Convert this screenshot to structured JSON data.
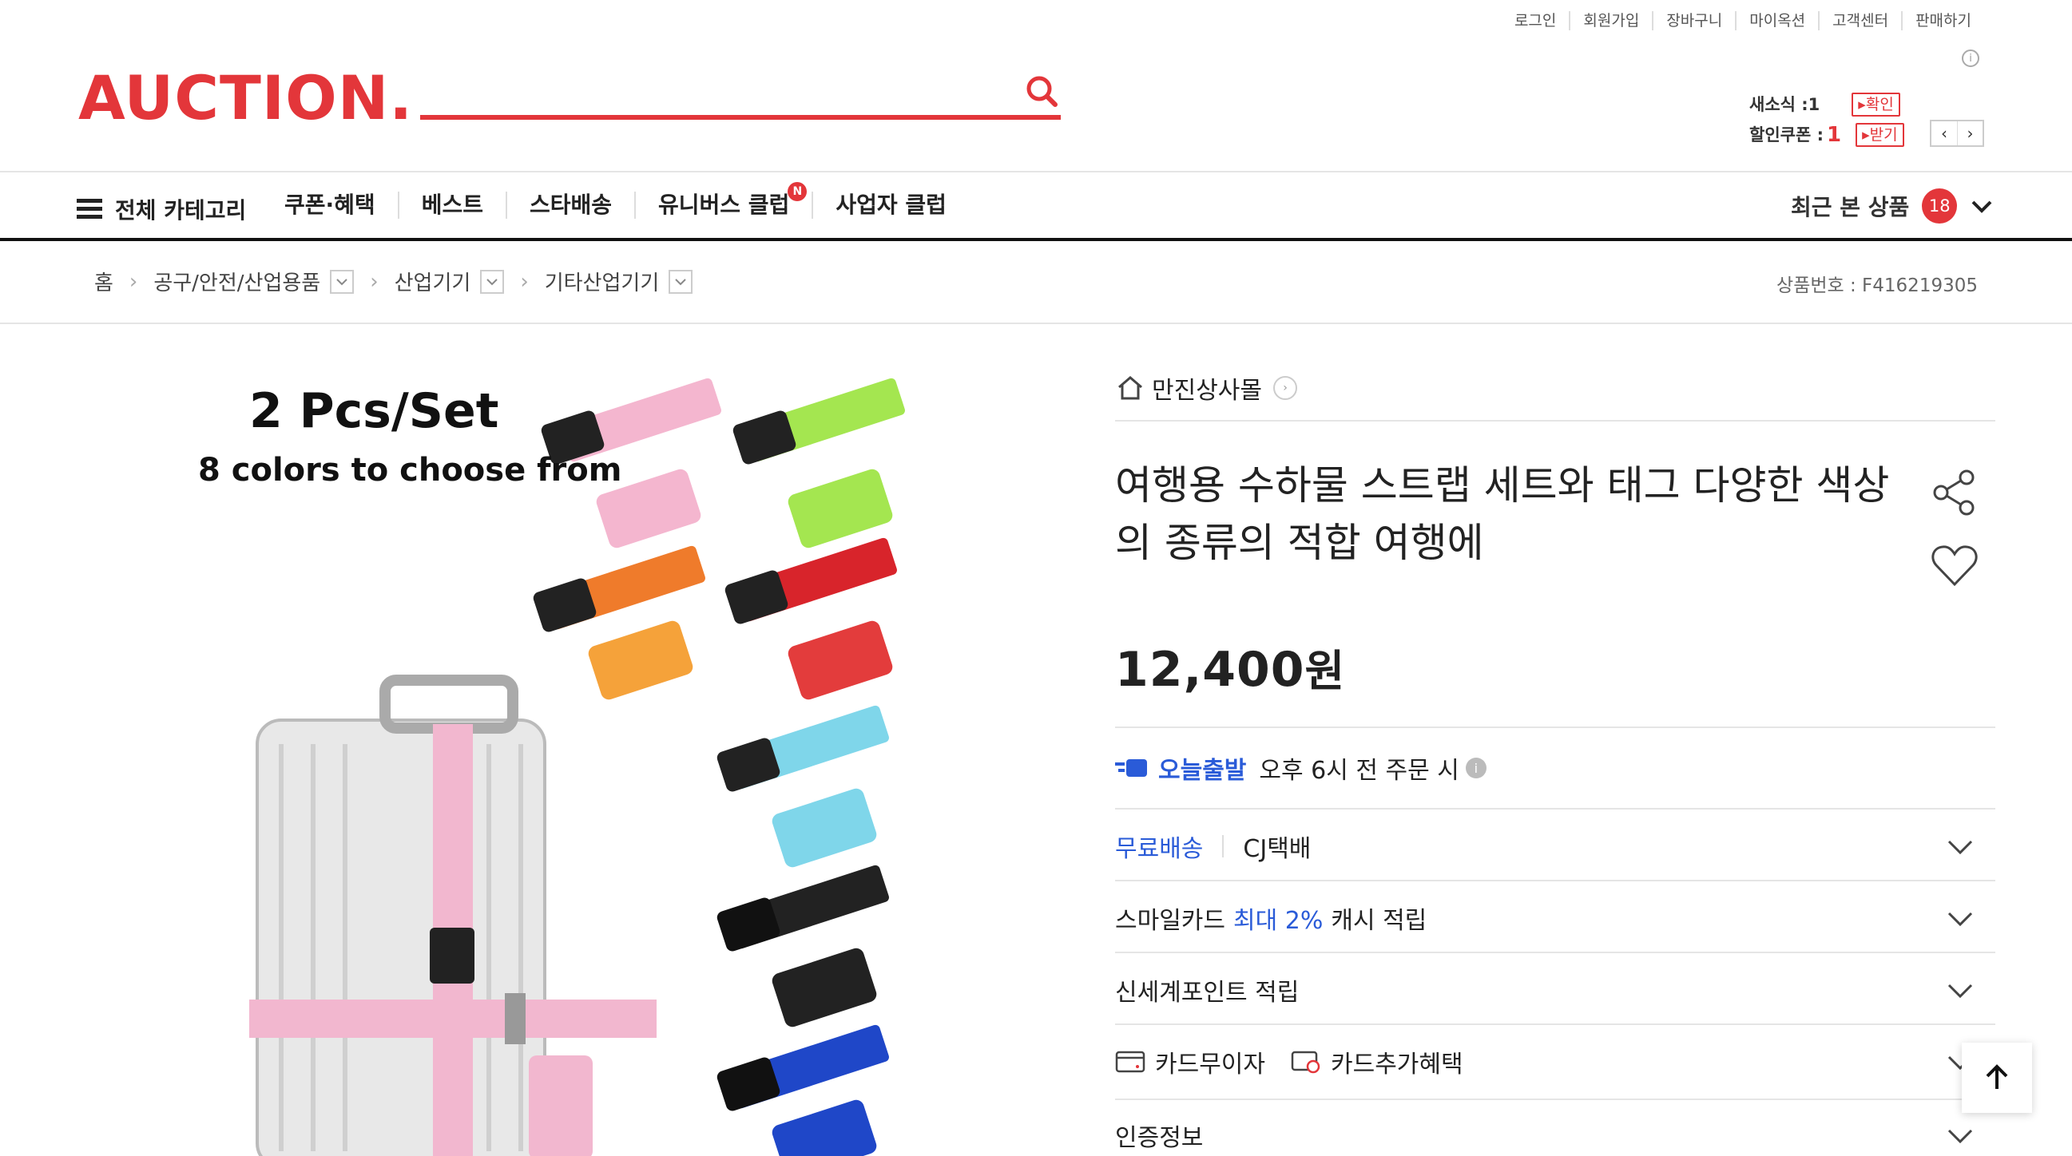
{
  "util_links": [
    "로그인",
    "회원가입",
    "장바구니",
    "마이옥션",
    "고객센터",
    "판매하기"
  ],
  "logo": "AUCTION.",
  "search": {
    "placeholder": ""
  },
  "notice": {
    "new_label": "새소식 :",
    "new_count": "1",
    "new_btn": "▸확인",
    "coupon_label": "할인쿠폰 :",
    "coupon_count": "1",
    "coupon_btn": "▸받기"
  },
  "nav": {
    "all_categories": "전체 카테고리",
    "links": [
      "쿠폰·혜택",
      "베스트",
      "스타배송",
      "유니버스 클럽",
      "사업자 클럽"
    ],
    "new_badge": "N",
    "recent_label": "최근 본 상품",
    "recent_count": "18"
  },
  "breadcrumb": {
    "home": "홈",
    "levels": [
      "공구/안전/산업용품",
      "산업기기",
      "기타산업기기"
    ],
    "product_no": "상품번호 : F416219305"
  },
  "image": {
    "title": "2 Pcs/Set",
    "subtitle": "8 colors to choose from"
  },
  "seller": "만진상사몰",
  "product": {
    "title": "여행용 수하물 스트랩 세트와 태그 다양한 색상의 종류의 적합 여행에",
    "price": "12,400",
    "price_unit": "원"
  },
  "shipping": {
    "today_label": "오늘출발",
    "today_desc": "오후 6시 전 주문 시"
  },
  "rows": {
    "delivery_free": "무료배송",
    "delivery_carrier": "CJ택배",
    "smile_prefix": "스마일카드",
    "smile_highlight": "최대 2%",
    "smile_suffix": "캐시 적립",
    "shinsegae": "신세계포인트 적립",
    "card_installment": "카드무이자",
    "card_benefit": "카드추가혜택",
    "certification": "인증정보"
  },
  "colors": {
    "brand": "#e3363a",
    "accent": "#2a5bd8"
  }
}
